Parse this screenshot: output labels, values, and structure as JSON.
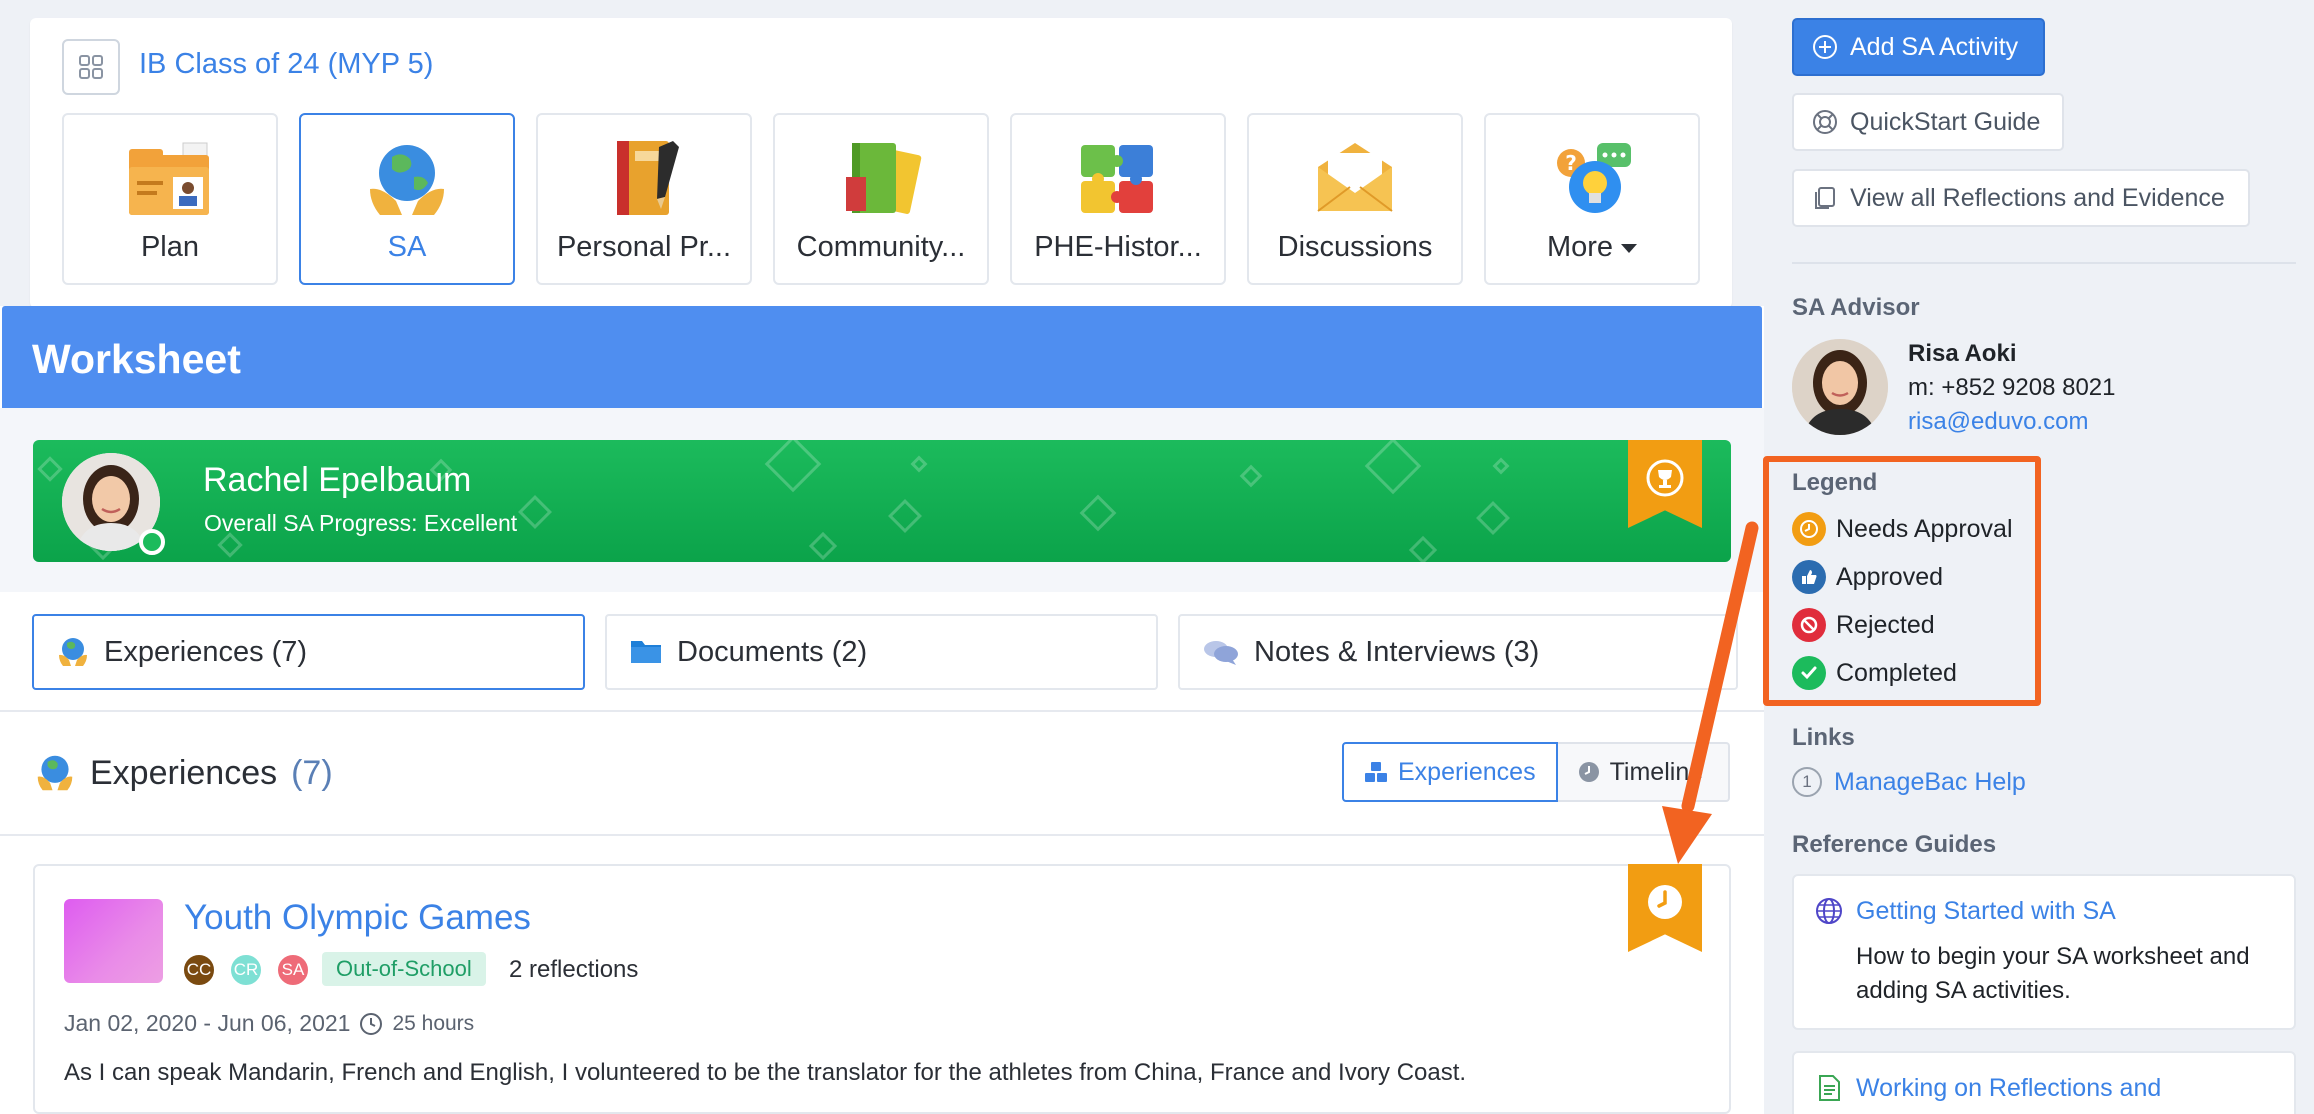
{
  "class_header": {
    "title": "IB Class of 24 (MYP 5)",
    "icon": "grid-icon"
  },
  "nav_tiles": [
    {
      "label": "Plan",
      "icon": "folder-plan-icon",
      "active": false
    },
    {
      "label": "SA",
      "icon": "globe-hands-icon",
      "active": true
    },
    {
      "label": "Personal Pr...",
      "icon": "notebook-icon",
      "active": false
    },
    {
      "label": "Community...",
      "icon": "books-icon",
      "active": false
    },
    {
      "label": "PHE-Histor...",
      "icon": "puzzle-icon",
      "active": false
    },
    {
      "label": "Discussions",
      "icon": "envelope-icon",
      "active": false
    },
    {
      "label": "More",
      "icon": "chat-bulb-icon",
      "active": false
    }
  ],
  "worksheet": {
    "title": "Worksheet",
    "student": {
      "name": "Rachel Epelbaum",
      "progress": "Overall SA Progress: Excellent"
    },
    "tabs": [
      {
        "label": "Experiences (7)",
        "icon": "globe-hands-icon"
      },
      {
        "label": "Documents (2)",
        "icon": "folder-icon"
      },
      {
        "label": "Notes & Interviews (3)",
        "icon": "speech-bubbles-icon"
      }
    ],
    "section": {
      "title": "Experiences",
      "count": "(7)",
      "view_toggle": {
        "experiences": "Experiences",
        "timeline": "Timeline"
      }
    },
    "experience": {
      "title": "Youth Olympic Games",
      "participants": [
        "CC",
        "CR",
        "SA"
      ],
      "tag": "Out-of-School",
      "reflections": "2 reflections",
      "dates": "Jan 02, 2020 - Jun 06, 2021",
      "hours": "25 hours",
      "description": "As I can speak Mandarin, French and English, I volunteered to be the translator for the athletes from China, France and Ivory Coast."
    }
  },
  "sidebar": {
    "add_button": "Add SA Activity",
    "quickstart_button": "QuickStart Guide",
    "view_all_button": "View all Reflections and Evidence",
    "advisor": {
      "heading": "SA Advisor",
      "name": "Risa Aoki",
      "phone": "m: +852 9208 8021",
      "email": "risa@eduvo.com"
    },
    "legend": {
      "heading": "Legend",
      "items": [
        {
          "label": "Needs Approval",
          "color": "#f29d12",
          "icon": "clock-icon"
        },
        {
          "label": "Approved",
          "color": "#2b6cb0",
          "icon": "thumbs-up-icon"
        },
        {
          "label": "Rejected",
          "color": "#e02d3c",
          "icon": "ban-icon"
        },
        {
          "label": "Completed",
          "color": "#1cbb5c",
          "icon": "check-icon"
        }
      ]
    },
    "links": {
      "heading": "Links",
      "items": [
        {
          "number": "1",
          "label": "ManageBac Help"
        }
      ]
    },
    "reference_guides": {
      "heading": "Reference Guides",
      "items": [
        {
          "title": "Getting Started with SA",
          "description": "How to begin your SA worksheet and adding SA activities."
        },
        {
          "title": "Working on Reflections and",
          "description": ""
        }
      ]
    }
  },
  "colors": {
    "accent": "#3b82e6",
    "header": "#4f8ef0",
    "banner": "#1cbb5c",
    "ribbon": "#f29d12",
    "annotation": "#f26321"
  }
}
